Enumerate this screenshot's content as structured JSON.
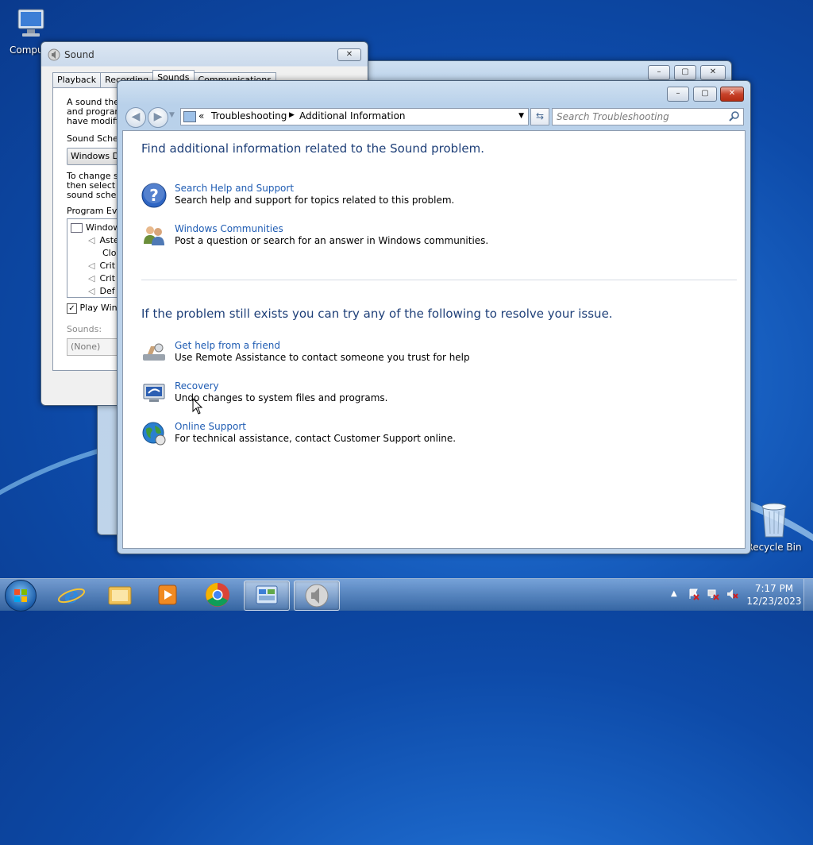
{
  "desktop": {
    "icons": [
      {
        "label": "Computer",
        "icon": "computer-icon"
      },
      {
        "label": "Recycle Bin",
        "icon": "recycle-bin-icon"
      }
    ]
  },
  "sound_dialog": {
    "title": "Sound",
    "close_label": "✕",
    "tabs": [
      "Playback",
      "Recording",
      "Sounds",
      "Communications"
    ],
    "active_tab": "Sounds",
    "intro_lines": [
      "A sound the",
      "and program",
      "have modifie"
    ],
    "scheme_label": "Sound Scher",
    "scheme_value": "Windows D",
    "change_lines": [
      "To change s",
      "then select a",
      "sound schen"
    ],
    "program_events_label": "Program Eve",
    "events": [
      "Window",
      "Aste",
      "Clos",
      "Crit",
      "Crit",
      "Def"
    ],
    "play_checkbox_label": "Play Wind",
    "sounds_label": "Sounds:",
    "sounds_value": "(None)"
  },
  "main_window": {
    "breadcrumb_root": "«",
    "breadcrumb": [
      "Troubleshooting",
      "Additional Information"
    ],
    "search_placeholder": "Search Troubleshooting",
    "heading1": "Find additional information related to the Sound problem.",
    "section1_items": [
      {
        "link": "Search Help and Support",
        "desc": "Search help and support for topics related to this problem.",
        "icon": "help-icon"
      },
      {
        "link": "Windows Communities",
        "desc": "Post a question or search for an answer in Windows communities.",
        "icon": "people-icon"
      }
    ],
    "heading2": "If the problem still exists you can try any of the following to resolve your issue.",
    "section2_items": [
      {
        "link": "Get help from a friend",
        "desc": "Use Remote Assistance to contact someone you trust for help",
        "icon": "remote-assistance-icon"
      },
      {
        "link": "Recovery",
        "desc": "Undo changes to system files and programs.",
        "icon": "recovery-icon"
      },
      {
        "link": "Online Support",
        "desc": "For technical assistance, contact Customer Support online.",
        "icon": "globe-icon"
      }
    ]
  },
  "taskbar": {
    "time": "7:17 PM",
    "date": "12/23/2023",
    "apps": [
      "start-orb-icon",
      "internet-explorer-icon",
      "file-explorer-icon",
      "media-player-icon",
      "chrome-icon",
      "control-panel-icon",
      "sound-icon"
    ]
  }
}
